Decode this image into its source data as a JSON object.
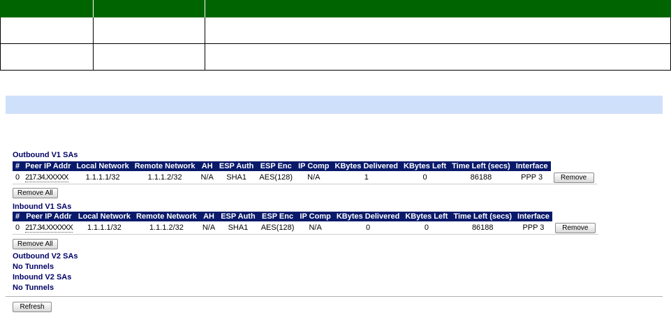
{
  "outbound_v1": {
    "title": "Outbound V1 SAs",
    "headers": [
      "#",
      "Peer IP Addr",
      "Local Network",
      "Remote Network",
      "AH",
      "ESP Auth",
      "ESP Enc",
      "IP Comp",
      "KBytes Delivered",
      "KBytes Left",
      "Time Left (secs)",
      "Interface"
    ],
    "row": {
      "idx": "0",
      "peer": "217.34.XXXXX",
      "local": "1.1.1.1/32",
      "remote": "1.1.1.2/32",
      "ah": "N/A",
      "esp_auth": "SHA1",
      "esp_enc": "AES(128)",
      "ip_comp": "N/A",
      "kb_delivered": "1",
      "kb_left": "0",
      "time_left": "86188",
      "interface": "PPP 3",
      "remove": "Remove"
    },
    "remove_all": "Remove All"
  },
  "inbound_v1": {
    "title": "Inbound V1 SAs",
    "headers": [
      "#",
      "Peer IP Addr",
      "Local Network",
      "Remote Network",
      "AH",
      "ESP Auth",
      "ESP Enc",
      "IP Comp",
      "KBytes Delivered",
      "KBytes Left",
      "Time Left (secs)",
      "Interface"
    ],
    "row": {
      "idx": "0",
      "peer": "217.34.XXXXXX",
      "local": "1.1.1.1/32",
      "remote": "1.1.1.2/32",
      "ah": "N/A",
      "esp_auth": "SHA1",
      "esp_enc": "AES(128)",
      "ip_comp": "N/A",
      "kb_delivered": "0",
      "kb_left": "0",
      "time_left": "86188",
      "interface": "PPP 3",
      "remove": "Remove"
    },
    "remove_all": "Remove All"
  },
  "outbound_v2": {
    "title": "Outbound V2 SAs",
    "status": "No Tunnels"
  },
  "inbound_v2": {
    "title": "Inbound V2 SAs",
    "status": "No Tunnels"
  },
  "refresh_label": "Refresh",
  "colors": {
    "green_header": "#006400",
    "blue_bar": "#cfe0fa",
    "table_header": "#0a1a6b",
    "title_text": "#000066"
  }
}
